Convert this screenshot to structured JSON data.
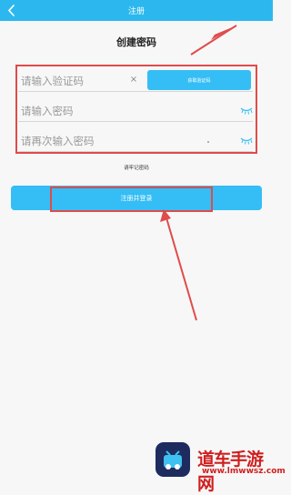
{
  "header": {
    "title": "注册"
  },
  "page": {
    "title": "创建密码"
  },
  "form": {
    "code_placeholder": "请输入验证码",
    "code_value": "",
    "clear_symbol": "×",
    "get_code_label": "获取验证码",
    "password_placeholder": "请输入密码",
    "password_confirm_placeholder": "请再次输入密码"
  },
  "note": "请牢记密码",
  "submit_label": "注册并登录",
  "colors": {
    "accent": "#2cb8ee",
    "button": "#35bdf5",
    "annotation": "#e04b4b"
  },
  "watermark": {
    "name": "道车手游网",
    "url": "www.lmwwsz.com"
  }
}
